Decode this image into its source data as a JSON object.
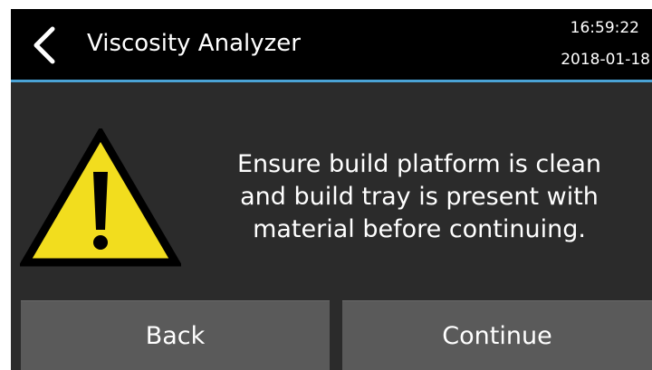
{
  "header": {
    "title": "Viscosity Analyzer",
    "time": "16:59:22",
    "date": "2018-01-18",
    "back_icon": "chevron-left-icon"
  },
  "dialog": {
    "icon": "warning-icon",
    "message_lines": [
      "Ensure build platform is clean",
      "and build tray is present with",
      "material before continuing."
    ]
  },
  "buttons": {
    "back_label": "Back",
    "continue_label": "Continue"
  },
  "colors": {
    "header_bg": "#000000",
    "accent_line": "#4aa3d6",
    "screen_bg": "#2b2b2b",
    "button_bg": "#5a5a5a",
    "warning_fill": "#f2dd1e"
  }
}
